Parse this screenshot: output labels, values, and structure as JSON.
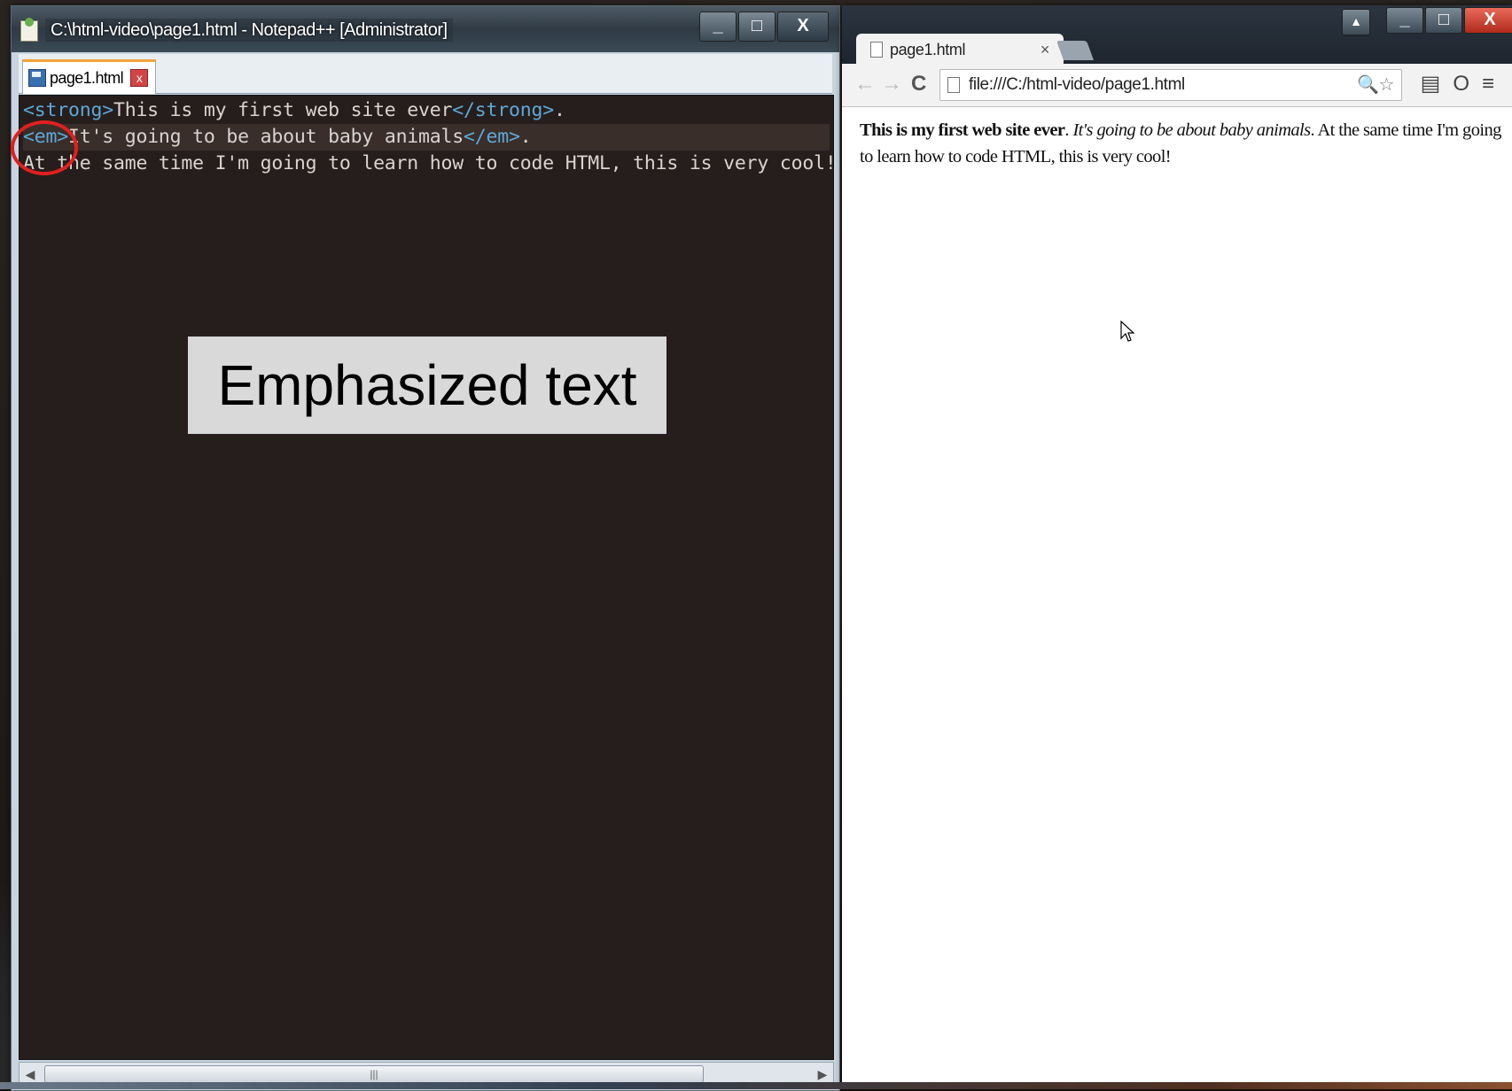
{
  "editor_window": {
    "title": "C:\\html-video\\page1.html - Notepad++ [Administrator]",
    "buttons": {
      "minimize": "_",
      "maximize": "□",
      "close": "X"
    },
    "tab": {
      "label": "page1.html",
      "close": "x"
    },
    "lines": [
      {
        "parts": [
          {
            "t": "<strong>",
            "tag": true
          },
          {
            "t": "This is my first web site ever"
          },
          {
            "t": "</strong>",
            "tag": true
          },
          {
            "t": "."
          }
        ]
      },
      {
        "parts": [
          {
            "t": "<em>",
            "tag": true
          },
          {
            "t": "It's going to be about baby animals"
          },
          {
            "t": "</em>",
            "tag": true
          },
          {
            "t": "."
          }
        ]
      },
      {
        "parts": [
          {
            "t": "At the same time I'm going to learn how to code HTML, this is very cool!"
          }
        ]
      }
    ],
    "scrollbar_grip": "|||",
    "scroll_left": "◀",
    "scroll_right": "▶"
  },
  "callout": {
    "text": "Emphasized text"
  },
  "browser_window": {
    "tab_title": "page1.html",
    "tab_close": "×",
    "url": "file:///C:/html-video/page1.html",
    "nav": {
      "back": "←",
      "forward": "→",
      "reload": "C"
    },
    "omni_icons": "🔍☆",
    "tools": "▤O≡",
    "buttons": {
      "extra": "▲",
      "minimize": "_",
      "maximize": "□",
      "close": "X"
    },
    "content": {
      "strong": "This is my first web site ever",
      "after_strong": ". ",
      "em": "It's going to be about baby animals",
      "after_em": ". At the same time I'm going to learn how to code HTML, this is very cool!"
    }
  },
  "colors": {
    "editor_bg": "#261e1c",
    "tag_color": "#5ea8d8",
    "text_color": "#d8d4cf",
    "highlight_circle": "#e02020"
  }
}
